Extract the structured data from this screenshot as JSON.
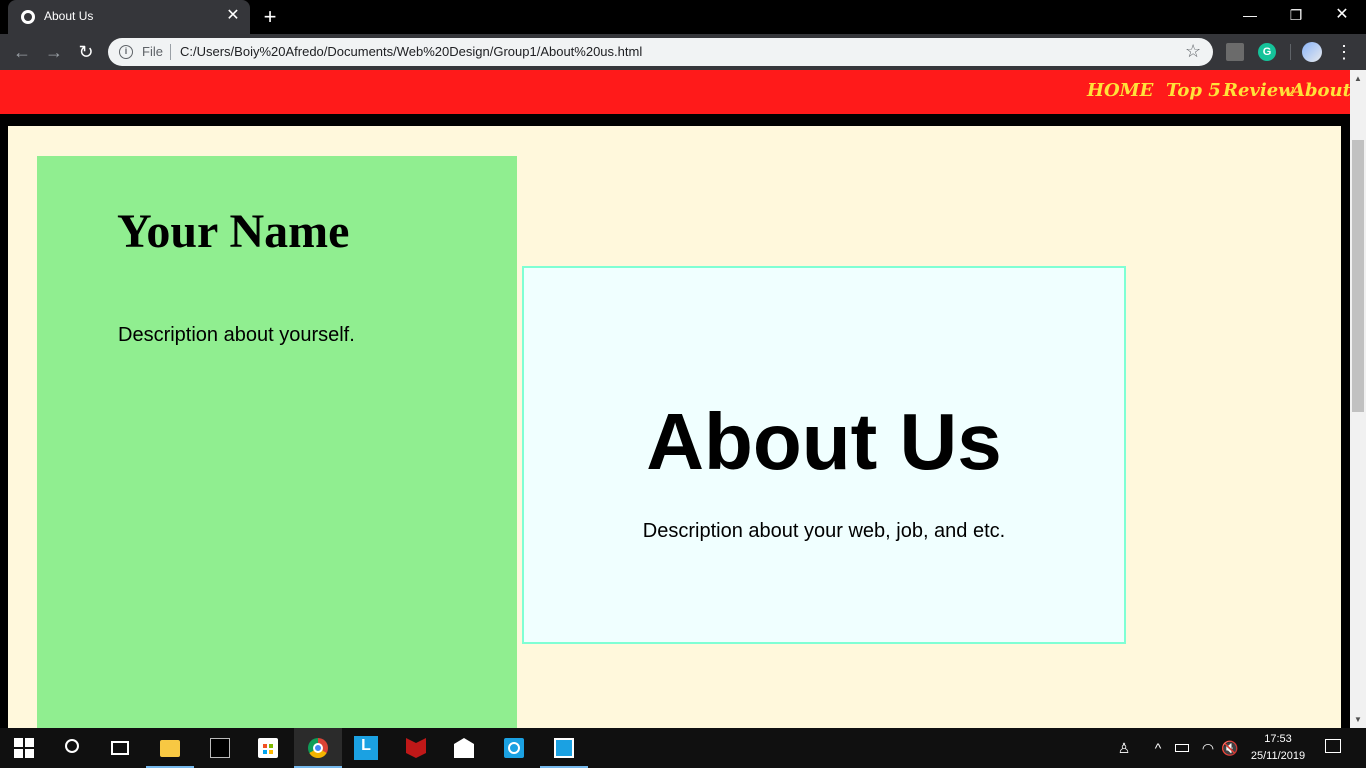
{
  "browser": {
    "tab_title": "About Us",
    "tab_close": "✕",
    "new_tab": "+",
    "window_controls": {
      "minimize": "—",
      "restore": "❐",
      "close": "✕"
    },
    "toolbar": {
      "back": "←",
      "forward": "→",
      "reload": "↻",
      "scheme_label": "File",
      "url": "C:/Users/Boiy%20Afredo/Documents/Web%20Design/Group1/About%20us.html",
      "bookmark_icon": "☆",
      "grammarly_label": "G",
      "menu_icon": "⋮"
    }
  },
  "page": {
    "nav": {
      "items": [
        "HOME",
        "Top 5",
        "Review",
        "About Us"
      ]
    },
    "left_card": {
      "name": "Your Name",
      "description": "Description about yourself."
    },
    "about": {
      "title": "About Us",
      "description": "Description about your web, job, and etc."
    },
    "colors": {
      "nav_background": "#ff1a1a",
      "nav_text": "#ffe23a",
      "page_background": "#fff8dc",
      "left_card": "#90ee90",
      "about_card": "#f0ffff",
      "about_border": "#7fffd4"
    }
  },
  "taskbar": {
    "items": [
      "start-icon",
      "search-icon",
      "task-view-icon",
      "file-explorer-icon",
      "terminal-icon",
      "store-icon",
      "chrome-icon",
      "l-app-icon",
      "mcafee-icon",
      "mail-icon",
      "whatsapp-icon",
      "remote-desktop-icon"
    ],
    "tray": {
      "chevron": "^",
      "volume": "🔇"
    },
    "clock": {
      "time": "17:53",
      "date": "25/11/2019"
    }
  }
}
